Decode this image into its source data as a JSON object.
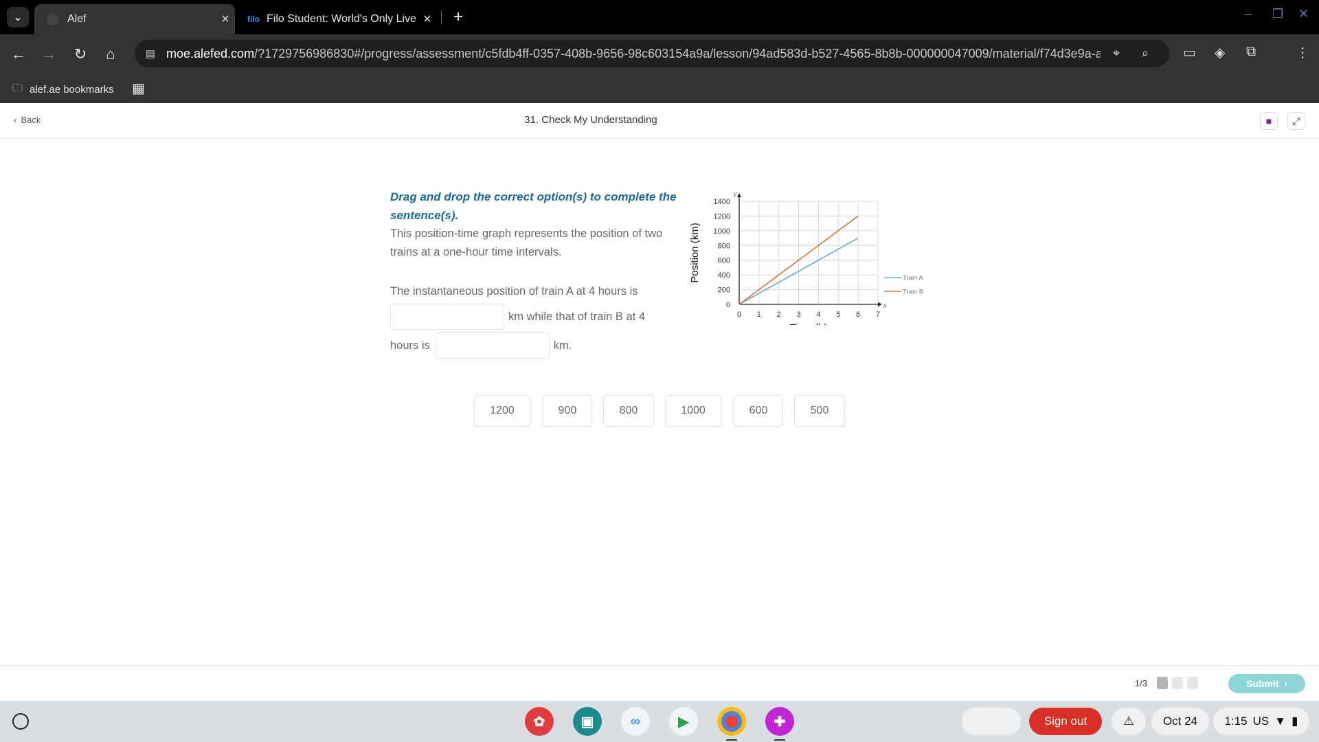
{
  "browser": {
    "tabs": [
      {
        "title": "Alef",
        "active": true
      },
      {
        "title": "Filo Student: World's Only Live I",
        "favicon_text": "filo",
        "active": false
      }
    ],
    "url_domain": "moe.alefed.com",
    "url_path": "/?1729756986830#/progress/assessment/c5fdb4ff-0357-408b-9656-98c603154a9a/lesson/94ad583d-b527-4565-8b8b-000000047009/material/f74d3e9a-a...",
    "bookmarks": [
      {
        "label": "alef.ae bookmarks"
      }
    ]
  },
  "page": {
    "back_label": "Back",
    "lesson_title": "31. Check My Understanding"
  },
  "question": {
    "instruction": "Drag and drop the correct option(s) to complete the sentence(s).",
    "description": "This position-time graph represents the position of two trains at a one-hour time intervals.",
    "sentence_part1": "The instantaneous position of train A at 4 hours is",
    "sentence_part2": "km while that of train B at 4",
    "sentence_part3": "hours is",
    "sentence_part4": "km."
  },
  "options": [
    "1200",
    "900",
    "800",
    "1000",
    "600",
    "500"
  ],
  "chart_data": {
    "type": "line",
    "xlabel": "Time (h)",
    "ylabel": "Position (km)",
    "x_axis_letter": "x",
    "y_axis_letter": "y",
    "xlim": [
      0,
      7
    ],
    "ylim": [
      0,
      1400
    ],
    "x_ticks": [
      "0",
      "1",
      "2",
      "3",
      "4",
      "5",
      "6",
      "7"
    ],
    "y_ticks": [
      "0",
      "200",
      "400",
      "600",
      "800",
      "1000",
      "1200",
      "1400"
    ],
    "grid": true,
    "legend_position": "right",
    "series": [
      {
        "name": "Train A",
        "color": "#6fa8d6",
        "x": [
          0,
          6
        ],
        "y": [
          0,
          900
        ]
      },
      {
        "name": "Train B",
        "color": "#d2773c",
        "x": [
          0,
          6
        ],
        "y": [
          0,
          1200
        ]
      }
    ]
  },
  "footer": {
    "pager": "1/3",
    "submit_label": "Submit"
  },
  "shelf": {
    "signout_label": "Sign out",
    "date": "Oct 24",
    "time": "1:15",
    "locale": "US"
  }
}
